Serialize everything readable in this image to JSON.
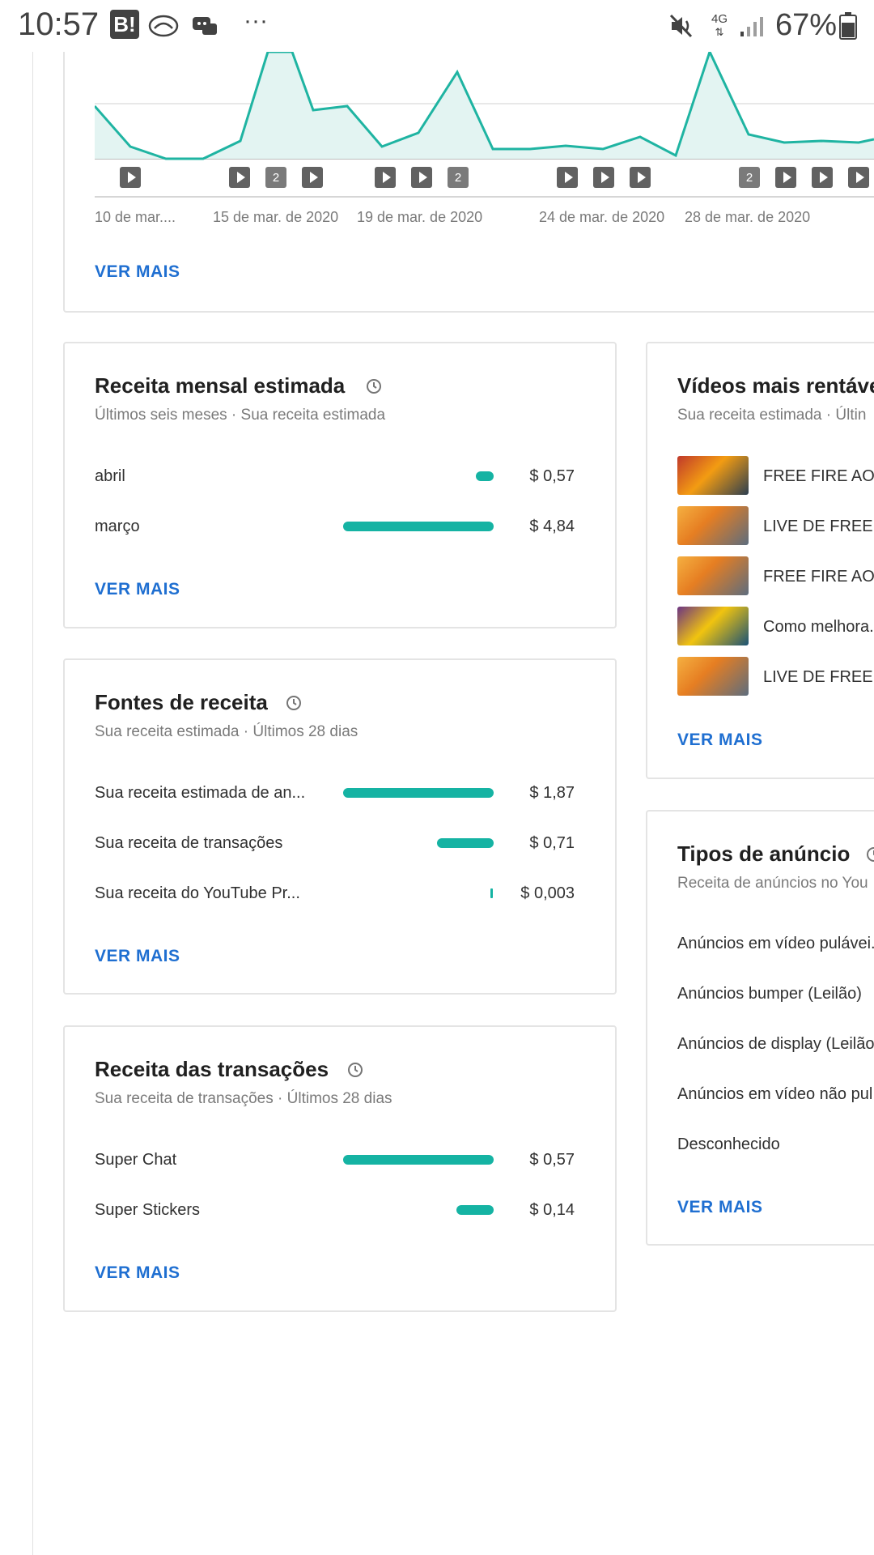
{
  "status_bar": {
    "time": "10:57",
    "network": "4G",
    "battery": "67%"
  },
  "chart": {
    "x_labels": [
      "10 de mar....",
      "15 de mar. de 2020",
      "19 de mar. de 2020",
      "24 de mar. de 2020",
      "28 de mar. de 2020"
    ],
    "marker_labels": [
      "2",
      "2",
      "2"
    ],
    "ver_mais": "VER MAIS"
  },
  "monthly_revenue": {
    "title": "Receita mensal estimada",
    "subtitle": "Últimos seis meses · Sua receita estimada",
    "rows": [
      {
        "label": "abril",
        "value": "$ 0,57",
        "fraction": 0.118
      },
      {
        "label": "março",
        "value": "$ 4,84",
        "fraction": 1.0
      }
    ],
    "ver_mais": "VER MAIS"
  },
  "revenue_sources": {
    "title": "Fontes de receita",
    "subtitle": "Sua receita estimada · Últimos 28 dias",
    "rows": [
      {
        "label": "Sua receita estimada de an...",
        "value": "$ 1,87",
        "fraction": 1.0
      },
      {
        "label": "Sua receita de transações",
        "value": "$ 0,71",
        "fraction": 0.38
      },
      {
        "label": "Sua receita do YouTube Pr...",
        "value": "$ 0,003",
        "fraction": 0.01
      }
    ],
    "ver_mais": "VER MAIS"
  },
  "transaction_revenue": {
    "title": "Receita das transações",
    "subtitle": "Sua receita de transações · Últimos 28 dias",
    "rows": [
      {
        "label": "Super Chat",
        "value": "$ 0,57",
        "fraction": 1.0
      },
      {
        "label": "Super Stickers",
        "value": "$ 0,14",
        "fraction": 0.25
      }
    ],
    "ver_mais": "VER MAIS"
  },
  "top_videos": {
    "title": "Vídeos mais rentáve",
    "subtitle": "Sua receita estimada · Últin",
    "items": [
      {
        "title": "FREE FIRE AO ..."
      },
      {
        "title": "LIVE DE FREE F"
      },
      {
        "title": "FREE FIRE AO ..."
      },
      {
        "title": "Como melhora..."
      },
      {
        "title": "LIVE DE FREE F"
      }
    ],
    "ver_mais": "VER MAIS"
  },
  "ad_types": {
    "title": "Tipos de anúncio",
    "subtitle": "Receita de anúncios no You",
    "rows": [
      {
        "label": "Anúncios em vídeo pulávei..."
      },
      {
        "label": "Anúncios bumper (Leilão)"
      },
      {
        "label": "Anúncios de display (Leilão"
      },
      {
        "label": "Anúncios em vídeo não pul"
      },
      {
        "label": "Desconhecido"
      }
    ],
    "ver_mais": "VER MAIS"
  },
  "colors": {
    "accent": "#15b3a3",
    "link": "#1f6fd1"
  }
}
